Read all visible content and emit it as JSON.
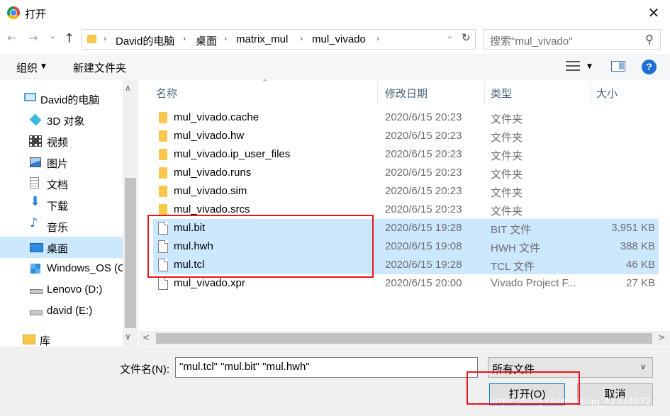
{
  "window": {
    "title": "打开",
    "close_glyph": "✕"
  },
  "nav": {
    "back_glyph": "←",
    "forward_glyph": "→",
    "history_glyph": "⌄",
    "up_glyph": "↑",
    "breadcrumbs": [
      "David的电脑",
      "桌面",
      "matrix_mul",
      "mul_vivado"
    ],
    "crumb_sep": "›",
    "refresh_glyph": "↻",
    "search_placeholder": "搜索\"mul_vivado\""
  },
  "toolbar": {
    "organize_label": "组织",
    "caret": "▼",
    "new_folder_label": "新建文件夹",
    "help_label": "?"
  },
  "sidebar": {
    "items": [
      {
        "label": "David的电脑",
        "icon": "computer-icon",
        "color": "#5aa0dc"
      },
      {
        "label": "3D 对象",
        "icon": "3d-objects-icon",
        "color": "#3fb8e0"
      },
      {
        "label": "视频",
        "icon": "video-icon",
        "color": "#444444"
      },
      {
        "label": "图片",
        "icon": "pictures-icon",
        "color": "#3a7bc8"
      },
      {
        "label": "文档",
        "icon": "documents-icon",
        "color": "#8c8c8c"
      },
      {
        "label": "下载",
        "icon": "downloads-icon",
        "color": "#2f7fd6"
      },
      {
        "label": "音乐",
        "icon": "music-icon",
        "color": "#2f7fd6"
      },
      {
        "label": "桌面",
        "icon": "desktop-icon",
        "color": "#2f8be0"
      },
      {
        "label": "Windows_OS (C",
        "icon": "windows-drive-icon",
        "color": "#2f8be0"
      },
      {
        "label": "Lenovo (D:)",
        "icon": "drive-icon",
        "color": "#8c8c8c"
      },
      {
        "label": "david (E:)",
        "icon": "drive-icon",
        "color": "#8c8c8c"
      },
      {
        "label": "库",
        "icon": "library-icon",
        "color": "#f8c74b"
      }
    ],
    "scroll_up": "∧",
    "scroll_down": "∨"
  },
  "columns": {
    "name": "名称",
    "modified": "修改日期",
    "type": "类型",
    "size": "大小",
    "sort_glyph": "⌃"
  },
  "files": [
    {
      "name": "mul_vivado.cache",
      "modified": "2020/6/15 20:23",
      "type": "文件夹",
      "size": "",
      "kind": "folder"
    },
    {
      "name": "mul_vivado.hw",
      "modified": "2020/6/15 20:23",
      "type": "文件夹",
      "size": "",
      "kind": "folder"
    },
    {
      "name": "mul_vivado.ip_user_files",
      "modified": "2020/6/15 20:23",
      "type": "文件夹",
      "size": "",
      "kind": "folder"
    },
    {
      "name": "mul_vivado.runs",
      "modified": "2020/6/15 20:23",
      "type": "文件夹",
      "size": "",
      "kind": "folder"
    },
    {
      "name": "mul_vivado.sim",
      "modified": "2020/6/15 20:23",
      "type": "文件夹",
      "size": "",
      "kind": "folder"
    },
    {
      "name": "mul_vivado.srcs",
      "modified": "2020/6/15 20:23",
      "type": "文件夹",
      "size": "",
      "kind": "folder"
    },
    {
      "name": "mul.bit",
      "modified": "2020/6/15 19:28",
      "type": "BIT 文件",
      "size": "3,951 KB",
      "kind": "file"
    },
    {
      "name": "mul.hwh",
      "modified": "2020/6/15 19:08",
      "type": "HWH 文件",
      "size": "388 KB",
      "kind": "file"
    },
    {
      "name": "mul.tcl",
      "modified": "2020/6/15 19:28",
      "type": "TCL 文件",
      "size": "46 KB",
      "kind": "file"
    },
    {
      "name": "mul_vivado.xpr",
      "modified": "2020/6/15 20:00",
      "type": "Vivado Project F...",
      "size": "27 KB",
      "kind": "file"
    }
  ],
  "hscroll": {
    "left": "<",
    "right": ">"
  },
  "footer": {
    "filename_label": "文件名(N):",
    "filename_value": "\"mul.tcl\" \"mul.bit\" \"mul.hwh\"",
    "filter_value": "所有文件",
    "filter_caret": "∨",
    "open_label": "打开(O)",
    "cancel_label": "取消",
    "watermark": "https://blog.csdn.net/qq_42334072"
  }
}
